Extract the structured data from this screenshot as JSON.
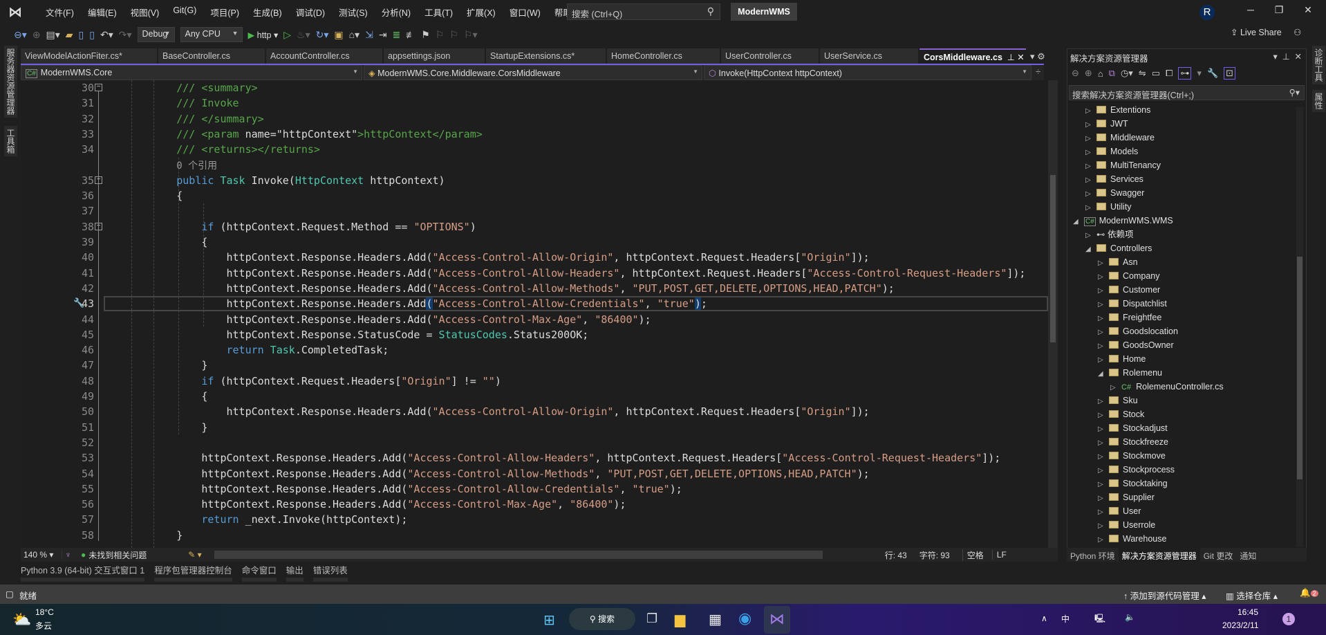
{
  "titlebar": {
    "menus": [
      "文件(F)",
      "编辑(E)",
      "视图(V)",
      "Git(G)",
      "项目(P)",
      "生成(B)",
      "调试(D)",
      "测试(S)",
      "分析(N)",
      "工具(T)",
      "扩展(X)",
      "窗口(W)",
      "帮助(H)"
    ],
    "search_placeholder": "搜索 (Ctrl+Q)",
    "solution_name": "ModernWMS",
    "avatar_initial": "R"
  },
  "toolbar": {
    "config": "Debug",
    "platform": "Any CPU",
    "run_target": "http",
    "live_share": "Live Share"
  },
  "left_strip": [
    "服务器资源管理器",
    "工具箱"
  ],
  "right_strip": [
    "诊断工具",
    "属性"
  ],
  "tabs": [
    {
      "label": "ViewModelActionFiter.cs*"
    },
    {
      "label": "BaseController.cs"
    },
    {
      "label": "AccountController.cs"
    },
    {
      "label": "appsettings.json"
    },
    {
      "label": "StartupExtensions.cs*"
    },
    {
      "label": "HomeController.cs"
    },
    {
      "label": "UserController.cs"
    },
    {
      "label": "UserService.cs"
    },
    {
      "label": "CorsMiddleware.cs",
      "active": true
    }
  ],
  "navbar": {
    "project": "ModernWMS.Core",
    "type": "ModernWMS.Core.Middleware.CorsMiddleware",
    "member": "Invoke(HttpContext httpContext)"
  },
  "editor": {
    "current_line": 43,
    "lines": [
      {
        "n": 30,
        "fold": true,
        "tokens": [
          [
            "p",
            "        "
          ],
          [
            "c",
            "/// <summary>"
          ]
        ]
      },
      {
        "n": 31,
        "tokens": [
          [
            "p",
            "        "
          ],
          [
            "c",
            "/// Invoke"
          ]
        ]
      },
      {
        "n": 32,
        "tokens": [
          [
            "p",
            "        "
          ],
          [
            "c",
            "/// </summary>"
          ]
        ]
      },
      {
        "n": 33,
        "tokens": [
          [
            "p",
            "        "
          ],
          [
            "c",
            "/// <param "
          ],
          [
            "p",
            "name=\"httpContext\""
          ],
          [
            "c",
            ">httpContext</param>"
          ]
        ]
      },
      {
        "n": 34,
        "tokens": [
          [
            "p",
            "        "
          ],
          [
            "c",
            "/// <returns></returns>"
          ]
        ]
      },
      {
        "n": null,
        "tokens": [
          [
            "p",
            "        "
          ],
          [
            "l",
            "0 个引用"
          ]
        ]
      },
      {
        "n": 35,
        "fold": true,
        "tokens": [
          [
            "p",
            "        "
          ],
          [
            "k",
            "public "
          ],
          [
            "t",
            "Task "
          ],
          [
            "p",
            "Invoke("
          ],
          [
            "t",
            "HttpContext "
          ],
          [
            "p",
            "httpContext)"
          ]
        ]
      },
      {
        "n": 36,
        "tokens": [
          [
            "p",
            "        {"
          ]
        ]
      },
      {
        "n": 37,
        "tokens": []
      },
      {
        "n": 38,
        "fold": true,
        "tokens": [
          [
            "p",
            "            "
          ],
          [
            "k",
            "if "
          ],
          [
            "p",
            "(httpContext.Request.Method == "
          ],
          [
            "s",
            "\"OPTIONS\""
          ],
          [
            "p",
            ")"
          ]
        ]
      },
      {
        "n": 39,
        "tokens": [
          [
            "p",
            "            {"
          ]
        ]
      },
      {
        "n": 40,
        "tokens": [
          [
            "p",
            "                httpContext.Response.Headers.Add("
          ],
          [
            "s",
            "\"Access-Control-Allow-Origin\""
          ],
          [
            "p",
            ", httpContext.Request.Headers["
          ],
          [
            "s",
            "\"Origin\""
          ],
          [
            "p",
            "]);"
          ]
        ]
      },
      {
        "n": 41,
        "tokens": [
          [
            "p",
            "                httpContext.Response.Headers.Add("
          ],
          [
            "s",
            "\"Access-Control-Allow-Headers\""
          ],
          [
            "p",
            ", httpContext.Request.Headers["
          ],
          [
            "s",
            "\"Access-Control-Request-Headers\""
          ],
          [
            "p",
            "]);"
          ]
        ]
      },
      {
        "n": 42,
        "tokens": [
          [
            "p",
            "                httpContext.Response.Headers.Add("
          ],
          [
            "s",
            "\"Access-Control-Allow-Methods\""
          ],
          [
            "p",
            ", "
          ],
          [
            "s",
            "\"PUT,POST,GET,DELETE,OPTIONS,HEAD,PATCH\""
          ],
          [
            "p",
            ");"
          ]
        ]
      },
      {
        "n": 43,
        "tokens": [
          [
            "p",
            "                httpContext.Response.Headers.Add"
          ],
          [
            "b",
            "("
          ],
          [
            "s",
            "\"Access-Control-Allow-Credentials\""
          ],
          [
            "p",
            ", "
          ],
          [
            "s",
            "\"true\""
          ],
          [
            "b",
            ")"
          ],
          [
            "p",
            ";"
          ]
        ]
      },
      {
        "n": 44,
        "tokens": [
          [
            "p",
            "                httpContext.Response.Headers.Add("
          ],
          [
            "s",
            "\"Access-Control-Max-Age\""
          ],
          [
            "p",
            ", "
          ],
          [
            "s",
            "\"86400\""
          ],
          [
            "p",
            ");"
          ]
        ]
      },
      {
        "n": 45,
        "tokens": [
          [
            "p",
            "                httpContext.Response.StatusCode = "
          ],
          [
            "t",
            "StatusCodes"
          ],
          [
            "p",
            ".Status200OK;"
          ]
        ]
      },
      {
        "n": 46,
        "tokens": [
          [
            "p",
            "                "
          ],
          [
            "k",
            "return "
          ],
          [
            "t",
            "Task"
          ],
          [
            "p",
            ".CompletedTask;"
          ]
        ]
      },
      {
        "n": 47,
        "tokens": [
          [
            "p",
            "            }"
          ]
        ]
      },
      {
        "n": 48,
        "tokens": [
          [
            "p",
            "            "
          ],
          [
            "k",
            "if "
          ],
          [
            "p",
            "(httpContext.Request.Headers["
          ],
          [
            "s",
            "\"Origin\""
          ],
          [
            "p",
            "] != "
          ],
          [
            "s",
            "\"\""
          ],
          [
            "p",
            ")"
          ]
        ]
      },
      {
        "n": 49,
        "tokens": [
          [
            "p",
            "            {"
          ]
        ]
      },
      {
        "n": 50,
        "tokens": [
          [
            "p",
            "                httpContext.Response.Headers.Add("
          ],
          [
            "s",
            "\"Access-Control-Allow-Origin\""
          ],
          [
            "p",
            ", httpContext.Request.Headers["
          ],
          [
            "s",
            "\"Origin\""
          ],
          [
            "p",
            "]);"
          ]
        ]
      },
      {
        "n": 51,
        "tokens": [
          [
            "p",
            "            }"
          ]
        ]
      },
      {
        "n": 52,
        "tokens": []
      },
      {
        "n": 53,
        "tokens": [
          [
            "p",
            "            httpContext.Response.Headers.Add("
          ],
          [
            "s",
            "\"Access-Control-Allow-Headers\""
          ],
          [
            "p",
            ", httpContext.Request.Headers["
          ],
          [
            "s",
            "\"Access-Control-Request-Headers\""
          ],
          [
            "p",
            "]);"
          ]
        ]
      },
      {
        "n": 54,
        "tokens": [
          [
            "p",
            "            httpContext.Response.Headers.Add("
          ],
          [
            "s",
            "\"Access-Control-Allow-Methods\""
          ],
          [
            "p",
            ", "
          ],
          [
            "s",
            "\"PUT,POST,GET,DELETE,OPTIONS,HEAD,PATCH\""
          ],
          [
            "p",
            ");"
          ]
        ]
      },
      {
        "n": 55,
        "tokens": [
          [
            "p",
            "            httpContext.Response.Headers.Add("
          ],
          [
            "s",
            "\"Access-Control-Allow-Credentials\""
          ],
          [
            "p",
            ", "
          ],
          [
            "s",
            "\"true\""
          ],
          [
            "p",
            ");"
          ]
        ]
      },
      {
        "n": 56,
        "tokens": [
          [
            "p",
            "            httpContext.Response.Headers.Add("
          ],
          [
            "s",
            "\"Access-Control-Max-Age\""
          ],
          [
            "p",
            ", "
          ],
          [
            "s",
            "\"86400\""
          ],
          [
            "p",
            ");"
          ]
        ]
      },
      {
        "n": 57,
        "tokens": [
          [
            "p",
            "            "
          ],
          [
            "k",
            "return "
          ],
          [
            "p",
            "_next.Invoke(httpContext);"
          ]
        ]
      },
      {
        "n": 58,
        "tokens": [
          [
            "p",
            "        }"
          ]
        ]
      }
    ]
  },
  "editor_status": {
    "zoom": "140 %",
    "issues": "未找到相关问题",
    "line": "行: 43",
    "char": "字符: 93",
    "spacing": "空格",
    "eol": "LF"
  },
  "bottom_tabs": [
    "Python 3.9 (64-bit) 交互式窗口 1",
    "程序包管理器控制台",
    "命令窗口",
    "输出",
    "错误列表"
  ],
  "solution_explorer": {
    "title": "解决方案资源管理器",
    "search_placeholder": "搜索解决方案资源管理器(Ctrl+;)",
    "items": [
      {
        "label": "Extentions",
        "level": 2,
        "kind": "folder",
        "state": "collapsed"
      },
      {
        "label": "JWT",
        "level": 2,
        "kind": "folder",
        "state": "collapsed"
      },
      {
        "label": "Middleware",
        "level": 2,
        "kind": "folder",
        "state": "collapsed"
      },
      {
        "label": "Models",
        "level": 2,
        "kind": "folder",
        "state": "collapsed"
      },
      {
        "label": "MultiTenancy",
        "level": 2,
        "kind": "folder",
        "state": "collapsed"
      },
      {
        "label": "Services",
        "level": 2,
        "kind": "folder",
        "state": "collapsed"
      },
      {
        "label": "Swagger",
        "level": 2,
        "kind": "folder",
        "state": "collapsed"
      },
      {
        "label": "Utility",
        "level": 2,
        "kind": "folder",
        "state": "collapsed"
      },
      {
        "label": "ModernWMS.WMS",
        "level": 1,
        "kind": "project",
        "state": "expanded"
      },
      {
        "label": "依赖项",
        "level": 2,
        "kind": "deps",
        "state": "collapsed"
      },
      {
        "label": "Controllers",
        "level": 2,
        "kind": "folder",
        "state": "expanded"
      },
      {
        "label": "Asn",
        "level": 3,
        "kind": "folder",
        "state": "collapsed"
      },
      {
        "label": "Company",
        "level": 3,
        "kind": "folder",
        "state": "collapsed"
      },
      {
        "label": "Customer",
        "level": 3,
        "kind": "folder",
        "state": "collapsed"
      },
      {
        "label": "Dispatchlist",
        "level": 3,
        "kind": "folder",
        "state": "collapsed"
      },
      {
        "label": "Freightfee",
        "level": 3,
        "kind": "folder",
        "state": "collapsed"
      },
      {
        "label": "Goodslocation",
        "level": 3,
        "kind": "folder",
        "state": "collapsed"
      },
      {
        "label": "GoodsOwner",
        "level": 3,
        "kind": "folder",
        "state": "collapsed"
      },
      {
        "label": "Home",
        "level": 3,
        "kind": "folder",
        "state": "collapsed"
      },
      {
        "label": "Rolemenu",
        "level": 3,
        "kind": "folder",
        "state": "expanded"
      },
      {
        "label": "RolemenuController.cs",
        "level": 4,
        "kind": "csfile",
        "state": "collapsed"
      },
      {
        "label": "Sku",
        "level": 3,
        "kind": "folder",
        "state": "collapsed"
      },
      {
        "label": "Stock",
        "level": 3,
        "kind": "folder",
        "state": "collapsed"
      },
      {
        "label": "Stockadjust",
        "level": 3,
        "kind": "folder",
        "state": "collapsed"
      },
      {
        "label": "Stockfreeze",
        "level": 3,
        "kind": "folder",
        "state": "collapsed"
      },
      {
        "label": "Stockmove",
        "level": 3,
        "kind": "folder",
        "state": "collapsed"
      },
      {
        "label": "Stockprocess",
        "level": 3,
        "kind": "folder",
        "state": "collapsed"
      },
      {
        "label": "Stocktaking",
        "level": 3,
        "kind": "folder",
        "state": "collapsed"
      },
      {
        "label": "Supplier",
        "level": 3,
        "kind": "folder",
        "state": "collapsed"
      },
      {
        "label": "User",
        "level": 3,
        "kind": "folder",
        "state": "collapsed"
      },
      {
        "label": "Userrole",
        "level": 3,
        "kind": "folder",
        "state": "collapsed"
      },
      {
        "label": "Warehouse",
        "level": 3,
        "kind": "folder",
        "state": "collapsed"
      }
    ],
    "bottom_tabs": [
      {
        "label": "Python 环境"
      },
      {
        "label": "解决方案资源管理器",
        "active": true
      },
      {
        "label": "Git 更改"
      },
      {
        "label": "通知"
      }
    ]
  },
  "statusbar": {
    "ready": "就绪",
    "add_source_control": "添加到源代码管理",
    "select_repo": "选择仓库",
    "notifications": "2"
  },
  "taskbar": {
    "temperature": "18°C",
    "weather": "多云",
    "search": "搜索",
    "ime": "中",
    "time": "16:45",
    "date": "2023/2/11",
    "badge": "1"
  },
  "colors": {
    "accent": "#8a63d2",
    "keyword": "#569cd6",
    "type": "#4ec9b0",
    "string": "#d69d85",
    "comment": "#57a64a"
  }
}
